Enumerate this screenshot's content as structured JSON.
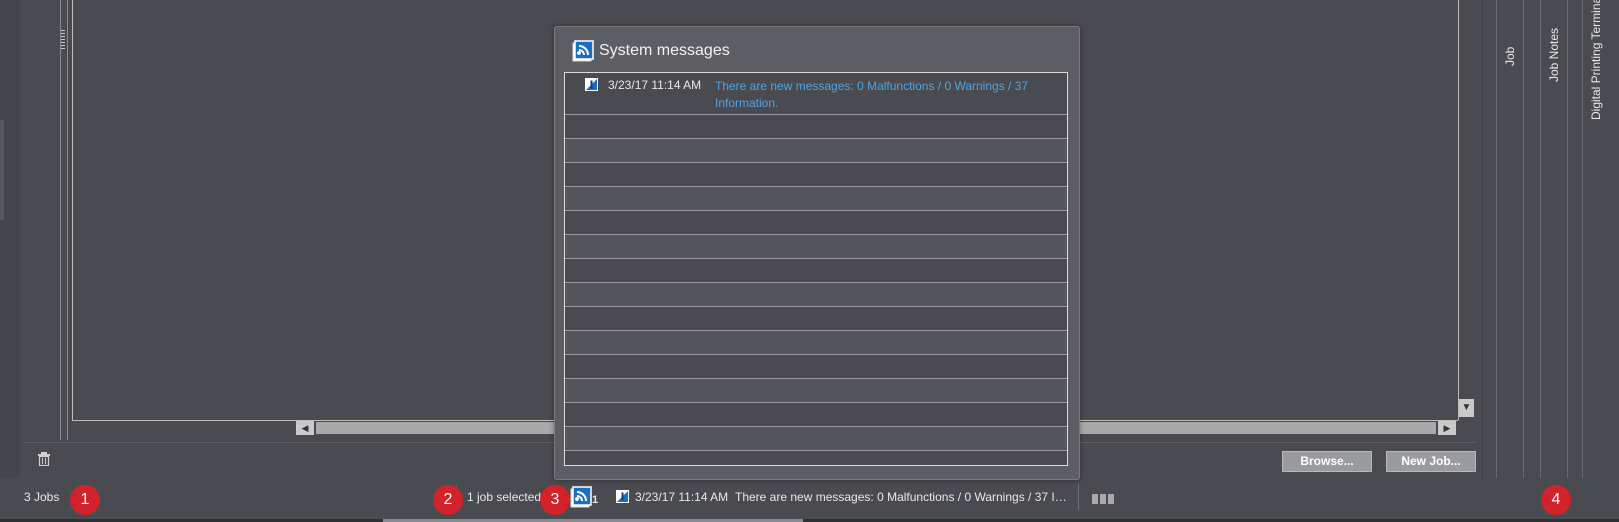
{
  "status": {
    "jobs_count": "3 Jobs",
    "selected": "1 job selected",
    "message_count": "1",
    "last_message_date": "3/23/17 11:14 AM",
    "last_message_text": "There are new messages: 0 Malfunctions / 0 Warnings / 37 Information."
  },
  "toolbar": {
    "browse_label": "Browse...",
    "new_job_label": "New Job..."
  },
  "side_tabs": {
    "job": "Job",
    "job_notes": "Job Notes",
    "digital_printing_terminal": "Digital Printing Terminal"
  },
  "dialog": {
    "title": "System messages",
    "messages": [
      {
        "date": "3/23/17 11:14 AM",
        "text": "There are new messages: 0 Malfunctions / 0 Warnings / 37 Information.",
        "icon": "info-icon"
      }
    ]
  },
  "badges": [
    "1",
    "2",
    "3",
    "4"
  ],
  "colors": {
    "background": "#4a4b50",
    "dialog_bg": "#5d5e64",
    "message_link": "#4fa3e0",
    "badge_red": "#d2222a",
    "icon_blue": "#1a6fc4"
  }
}
